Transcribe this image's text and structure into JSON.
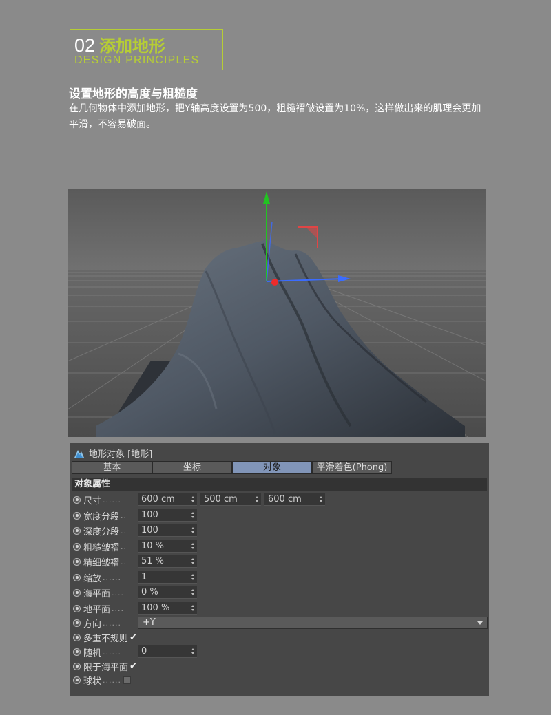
{
  "header": {
    "number": "02",
    "title": "添加地形",
    "subtitle": "DESIGN PRINCIPLES"
  },
  "intro": {
    "heading": "设置地形的高度与粗糙度",
    "description": "在几何物体中添加地形，把Y轴高度设置为500，粗糙褶皱设置为10%，这样做出来的肌理会更加平滑，不容易破面。"
  },
  "panel": {
    "title": "地形对象 [地形]",
    "tabs": [
      {
        "label": "基本",
        "active": false
      },
      {
        "label": "坐标",
        "active": false
      },
      {
        "label": "对象",
        "active": true
      },
      {
        "label": "平滑着色(Phong)",
        "active": false
      }
    ],
    "section": "对象属性",
    "size": {
      "label": "尺寸",
      "dots": "......",
      "x": "600 cm",
      "y": "500 cm",
      "z": "600 cm"
    },
    "rows": [
      {
        "label": "宽度分段",
        "dots": "..",
        "value": "100"
      },
      {
        "label": "深度分段",
        "dots": "..",
        "value": "100"
      },
      {
        "label": "粗糙皱褶",
        "dots": "..",
        "value": "10 %"
      },
      {
        "label": "精细皱褶",
        "dots": "..",
        "value": "51 %"
      },
      {
        "label": "缩放",
        "dots": "......",
        "value": "1"
      },
      {
        "label": "海平面",
        "dots": "....",
        "value": "0 %"
      },
      {
        "label": "地平面",
        "dots": "....",
        "value": "100 %"
      }
    ],
    "direction": {
      "label": "方向",
      "dots": "......",
      "value": "+Y"
    },
    "multi_fractal": {
      "label": "多重不规则",
      "checked": true
    },
    "seed": {
      "label": "随机",
      "dots": "......",
      "value": "0"
    },
    "limit_sea": {
      "label": "限于海平面",
      "checked": true
    },
    "spherical": {
      "label": "球状",
      "dots": "......",
      "checked": false
    }
  },
  "colors": {
    "accent": "#b6cd35",
    "background": "#8a8a8a",
    "panel": "#474747",
    "active_tab": "#8195b8"
  }
}
